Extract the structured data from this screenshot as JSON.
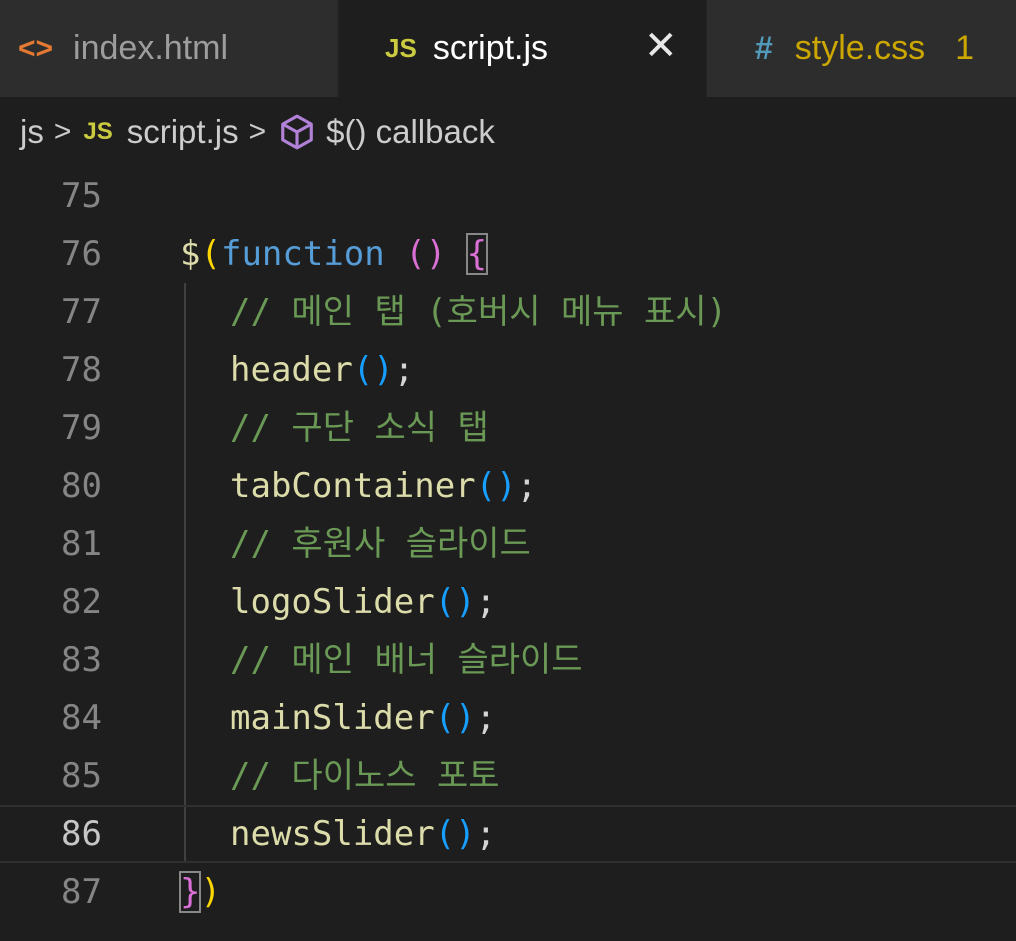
{
  "tabs": [
    {
      "icon": "html-icon",
      "icon_glyph": "<>",
      "label": "index.html"
    },
    {
      "icon": "javascript-icon",
      "icon_glyph": "JS",
      "label": "script.js",
      "active": true,
      "close": "✕"
    },
    {
      "icon": "css-icon",
      "icon_glyph": "#",
      "label": "style.css",
      "problems": "1"
    }
  ],
  "breadcrumb": {
    "folder": "js",
    "file_badge": "JS",
    "file": "script.js",
    "symbol": "$() callback",
    "separator": ">"
  },
  "code": {
    "current_line": 86,
    "lines": [
      {
        "number": "75"
      },
      {
        "number": "76",
        "dollar": "$",
        "open_paren": "(",
        "keyword": "function",
        "params": "()",
        "open_brace": "{"
      },
      {
        "number": "77",
        "comment": "// 메인 탭 (호버시 메뉴 표시)"
      },
      {
        "number": "78",
        "fn": "header",
        "call": "()",
        "semi": ";"
      },
      {
        "number": "79",
        "comment": "// 구단 소식 탭"
      },
      {
        "number": "80",
        "fn": "tabContainer",
        "call": "()",
        "semi": ";"
      },
      {
        "number": "81",
        "comment": "// 후원사 슬라이드"
      },
      {
        "number": "82",
        "fn": "logoSlider",
        "call": "()",
        "semi": ";"
      },
      {
        "number": "83",
        "comment": "// 메인 배너 슬라이드"
      },
      {
        "number": "84",
        "fn": "mainSlider",
        "call": "()",
        "semi": ";"
      },
      {
        "number": "85",
        "comment": "// 다이노스 포토"
      },
      {
        "number": "86",
        "fn": "newsSlider",
        "call": "()",
        "semi": ";"
      },
      {
        "number": "87",
        "close_brace": "}",
        "close_paren": ")"
      }
    ]
  },
  "colors": {
    "background": "#1e1e1e",
    "keyword": "#569cd6",
    "function": "#dcdcaa",
    "comment": "#6a9955",
    "bracket_1": "#ffd700",
    "bracket_2": "#da70d6",
    "bracket_3": "#179fff"
  }
}
